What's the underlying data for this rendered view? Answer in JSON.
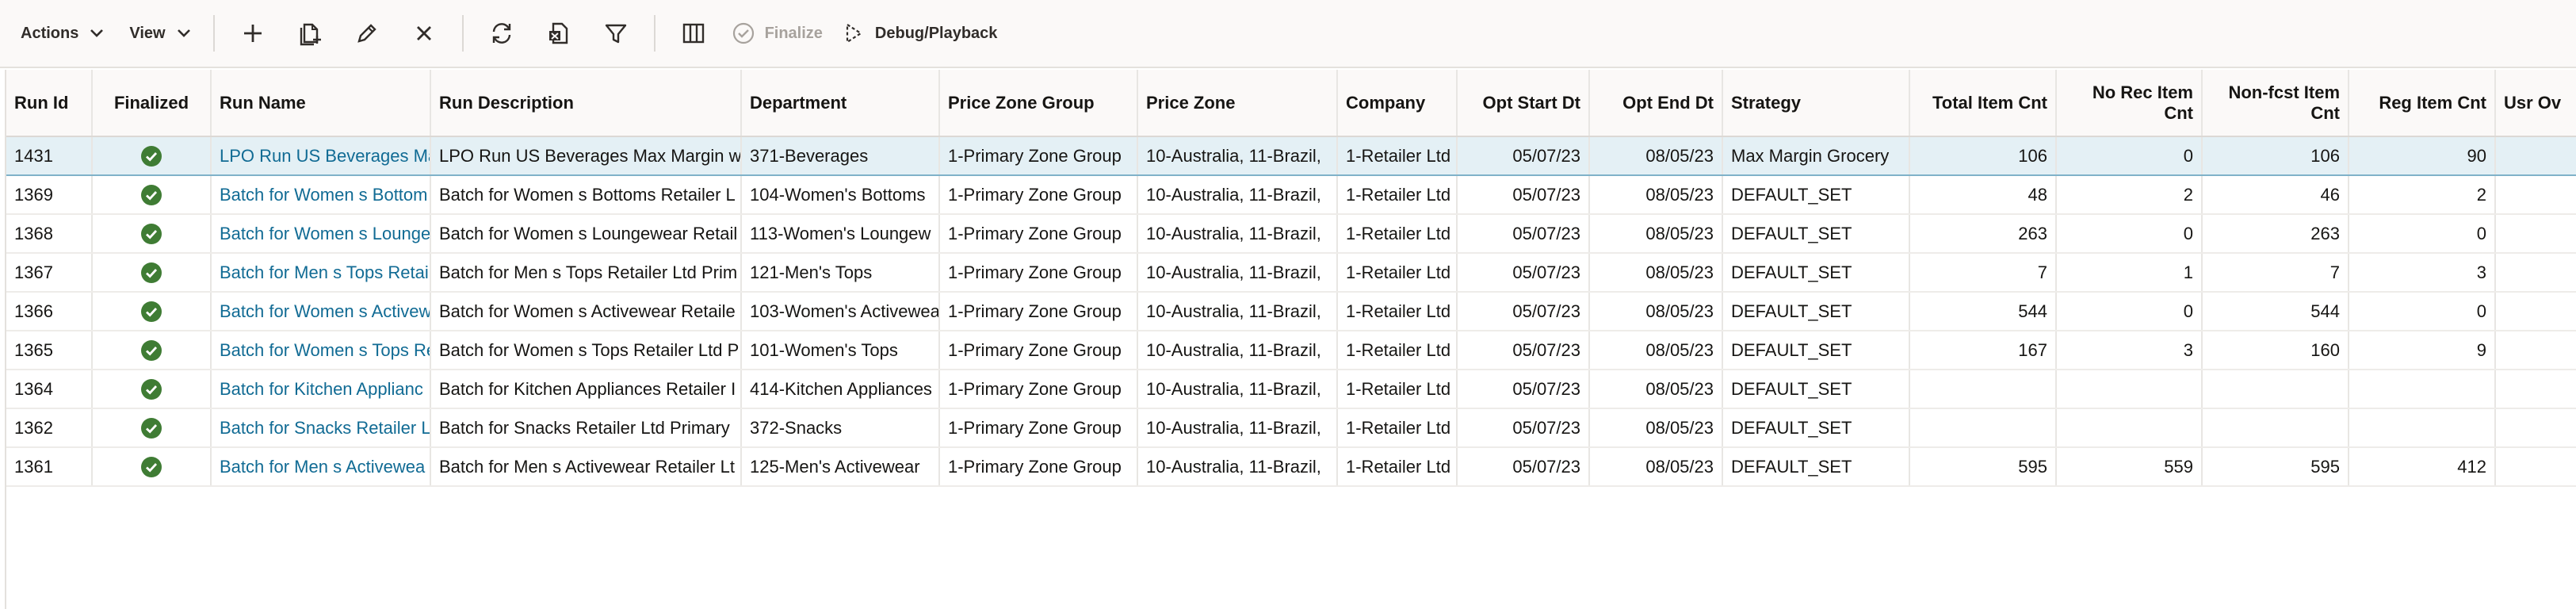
{
  "toolbar": {
    "actions_label": "Actions",
    "view_label": "View",
    "finalize_label": "Finalize",
    "debug_label": "Debug/Playback",
    "icons": [
      "add-icon",
      "duplicate-icon",
      "edit-icon",
      "delete-icon",
      "refresh-icon",
      "export-icon",
      "filter-icon",
      "columns-icon"
    ]
  },
  "table": {
    "headers": {
      "run_id": "Run Id",
      "finalized": "Finalized",
      "run_name": "Run Name",
      "run_description": "Run Description",
      "department": "Department",
      "price_zone_group": "Price Zone Group",
      "price_zone": "Price Zone",
      "company": "Company",
      "opt_start_dt": "Opt Start Dt",
      "opt_end_dt": "Opt End Dt",
      "strategy": "Strategy",
      "total_item_cnt": "Total Item Cnt",
      "no_rec_item_cnt_1": "No Rec Item",
      "no_rec_item_cnt_2": "Cnt",
      "non_fcst_item_cnt_1": "Non-fcst Item",
      "non_fcst_item_cnt_2": "Cnt",
      "reg_item_cnt": "Reg Item Cnt",
      "usr_ov": "Usr Ov"
    },
    "rows": [
      {
        "run_id": "1431",
        "run_name": "LPO Run US Beverages Ma",
        "run_description": "LPO Run US Beverages Max Margin w",
        "department": "371-Beverages",
        "price_zone_group": "1-Primary Zone Group",
        "price_zone": "10-Australia, 11-Brazil,",
        "company": "1-Retailer Ltd",
        "opt_start_dt": "05/07/23",
        "opt_end_dt": "08/05/23",
        "strategy": "Max Margin Grocery",
        "total": "106",
        "no_rec": "0",
        "non_fcst": "106",
        "reg": "90"
      },
      {
        "run_id": "1369",
        "run_name": "Batch for Women s Bottom",
        "run_description": "Batch for Women s Bottoms Retailer L",
        "department": "104-Women's Bottoms",
        "price_zone_group": "1-Primary Zone Group",
        "price_zone": "10-Australia, 11-Brazil,",
        "company": "1-Retailer Ltd",
        "opt_start_dt": "05/07/23",
        "opt_end_dt": "08/05/23",
        "strategy": "DEFAULT_SET",
        "total": "48",
        "no_rec": "2",
        "non_fcst": "46",
        "reg": "2"
      },
      {
        "run_id": "1368",
        "run_name": "Batch for Women s Lounge",
        "run_description": "Batch for Women s Loungewear Retail",
        "department": "113-Women's Loungew",
        "price_zone_group": "1-Primary Zone Group",
        "price_zone": "10-Australia, 11-Brazil,",
        "company": "1-Retailer Ltd",
        "opt_start_dt": "05/07/23",
        "opt_end_dt": "08/05/23",
        "strategy": "DEFAULT_SET",
        "total": "263",
        "no_rec": "0",
        "non_fcst": "263",
        "reg": "0"
      },
      {
        "run_id": "1367",
        "run_name": "Batch for Men s Tops Retai",
        "run_description": "Batch for Men s Tops Retailer Ltd Prim",
        "department": "121-Men's Tops",
        "price_zone_group": "1-Primary Zone Group",
        "price_zone": "10-Australia, 11-Brazil,",
        "company": "1-Retailer Ltd",
        "opt_start_dt": "05/07/23",
        "opt_end_dt": "08/05/23",
        "strategy": "DEFAULT_SET",
        "total": "7",
        "no_rec": "1",
        "non_fcst": "7",
        "reg": "3"
      },
      {
        "run_id": "1366",
        "run_name": "Batch for Women s Activew",
        "run_description": "Batch for Women s Activewear Retaile",
        "department": "103-Women's Activewea",
        "price_zone_group": "1-Primary Zone Group",
        "price_zone": "10-Australia, 11-Brazil,",
        "company": "1-Retailer Ltd",
        "opt_start_dt": "05/07/23",
        "opt_end_dt": "08/05/23",
        "strategy": "DEFAULT_SET",
        "total": "544",
        "no_rec": "0",
        "non_fcst": "544",
        "reg": "0"
      },
      {
        "run_id": "1365",
        "run_name": "Batch for Women s Tops Re",
        "run_description": "Batch for Women s Tops Retailer Ltd P",
        "department": "101-Women's Tops",
        "price_zone_group": "1-Primary Zone Group",
        "price_zone": "10-Australia, 11-Brazil,",
        "company": "1-Retailer Ltd",
        "opt_start_dt": "05/07/23",
        "opt_end_dt": "08/05/23",
        "strategy": "DEFAULT_SET",
        "total": "167",
        "no_rec": "3",
        "non_fcst": "160",
        "reg": "9"
      },
      {
        "run_id": "1364",
        "run_name": "Batch for Kitchen Applianc",
        "run_description": "Batch for Kitchen Appliances Retailer I",
        "department": "414-Kitchen Appliances",
        "price_zone_group": "1-Primary Zone Group",
        "price_zone": "10-Australia, 11-Brazil,",
        "company": "1-Retailer Ltd",
        "opt_start_dt": "05/07/23",
        "opt_end_dt": "08/05/23",
        "strategy": "DEFAULT_SET",
        "total": "",
        "no_rec": "",
        "non_fcst": "",
        "reg": ""
      },
      {
        "run_id": "1362",
        "run_name": "Batch for Snacks Retailer L",
        "run_description": "Batch for Snacks Retailer Ltd Primary",
        "department": "372-Snacks",
        "price_zone_group": "1-Primary Zone Group",
        "price_zone": "10-Australia, 11-Brazil,",
        "company": "1-Retailer Ltd",
        "opt_start_dt": "05/07/23",
        "opt_end_dt": "08/05/23",
        "strategy": "DEFAULT_SET",
        "total": "",
        "no_rec": "",
        "non_fcst": "",
        "reg": ""
      },
      {
        "run_id": "1361",
        "run_name": "Batch for Men s Activewea",
        "run_description": "Batch for Men s Activewear Retailer Lt",
        "department": "125-Men's Activewear",
        "price_zone_group": "1-Primary Zone Group",
        "price_zone": "10-Australia, 11-Brazil,",
        "company": "1-Retailer Ltd",
        "opt_start_dt": "05/07/23",
        "opt_end_dt": "08/05/23",
        "strategy": "DEFAULT_SET",
        "total": "595",
        "no_rec": "559",
        "non_fcst": "595",
        "reg": "412"
      }
    ]
  },
  "colors": {
    "finalized_check": "#3f7c34",
    "link": "#116b94",
    "selected_row": "#e4f0f5"
  }
}
